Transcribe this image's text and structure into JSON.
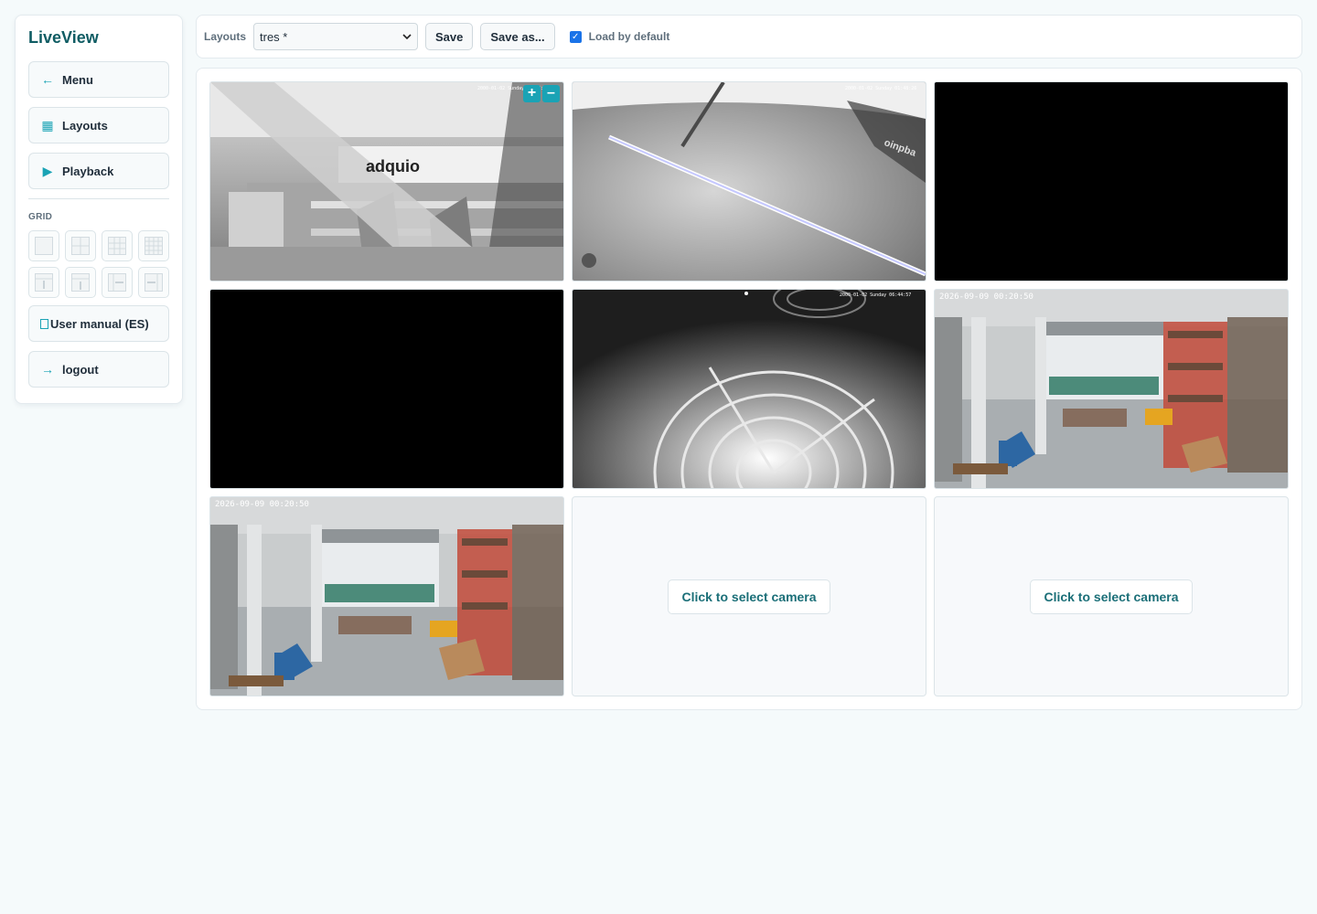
{
  "sidebar": {
    "brand": "LiveView",
    "nav": [
      {
        "icon": "arrow-left-icon",
        "glyph": "←",
        "label": "Menu"
      },
      {
        "icon": "grid-icon",
        "glyph": "▦",
        "label": "Layouts"
      },
      {
        "icon": "play-icon",
        "glyph": "▶",
        "label": "Playback"
      }
    ],
    "grid_label": "GRID",
    "manual_label": "User manual (ES)",
    "logout_label": "logout",
    "logout_glyph": "→"
  },
  "toolbar": {
    "layouts_label": "Layouts",
    "layout_selected": "tres *",
    "save_label": "Save",
    "save_as_label": "Save as...",
    "load_default_label": "Load by default",
    "load_default_checked": true
  },
  "cameras": [
    {
      "type": "feed",
      "timestamp": "2000-01-02 Sunday 01:48:26",
      "brand_text": "adquio"
    },
    {
      "type": "feed",
      "timestamp": "2000-01-02 Sunday 01:48:26",
      "brand_text": "oinpba"
    },
    {
      "type": "black"
    },
    {
      "type": "black"
    },
    {
      "type": "feed",
      "timestamp": "2000-01-02 Sunday 06:44:57"
    },
    {
      "type": "feed",
      "timestamp": "2026-09-09 00:20:50"
    },
    {
      "type": "feed",
      "timestamp": "2026-09-09 00:20:50"
    },
    {
      "type": "empty",
      "label": "Click to select camera"
    },
    {
      "type": "empty",
      "label": "Click to select camera"
    }
  ],
  "zoom": {
    "plus": "+",
    "minus": "–"
  },
  "colors": {
    "accent": "#1aa3b5",
    "brand": "#0f5c63"
  }
}
